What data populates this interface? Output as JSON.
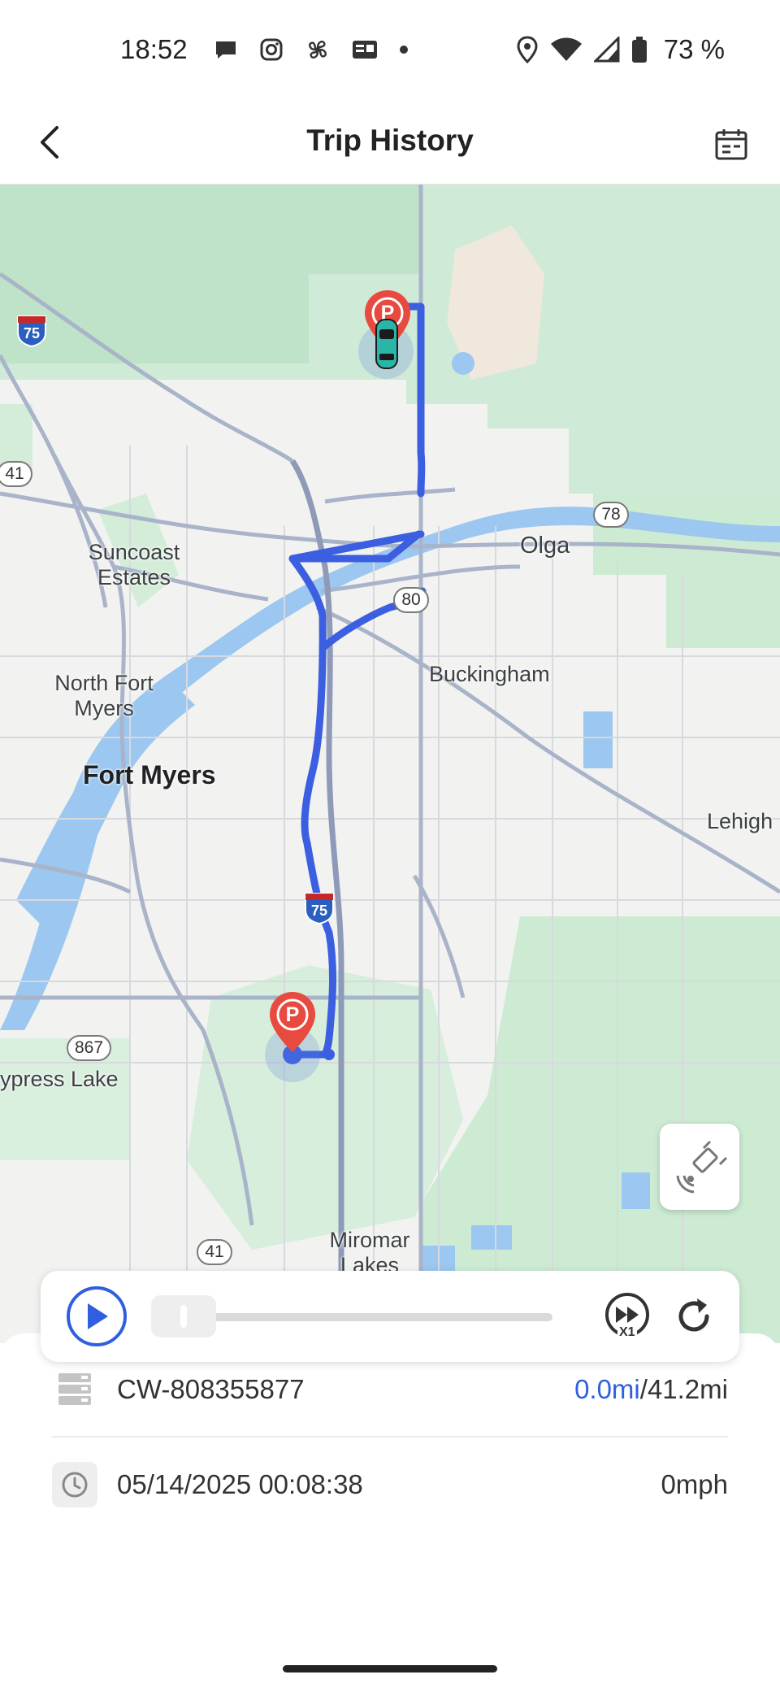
{
  "status_bar": {
    "time": "18:52",
    "battery": "73 %",
    "icons": [
      "chat-icon",
      "instagram-icon",
      "pinwheel-icon",
      "news-icon",
      "dot-icon",
      "location-icon",
      "wifi-icon",
      "signal-icon",
      "battery-icon"
    ]
  },
  "header": {
    "title": "Trip History",
    "back_icon": "chevron-left-icon",
    "calendar_icon": "calendar-icon"
  },
  "map": {
    "labels": {
      "suncoast": "Suncoast\nEstates",
      "olga": "Olga",
      "buckingham": "Buckingham",
      "north_fort_myers": "North Fort\nMyers",
      "fort_myers": "Fort Myers",
      "lehigh": "Lehigh",
      "cypress_lake": "ypress Lake",
      "miromar": "Miromar\nLakes"
    },
    "shields": {
      "i75_top": "75",
      "i75_mid": "75",
      "us41_top": "41",
      "us41_bottom": "41",
      "sr78": "78",
      "sr80": "80",
      "cr867": "867"
    },
    "route_color": "#3b5fe0",
    "parking_marker_label": "P",
    "parking_color": "#e84a3f"
  },
  "playback": {
    "progress": 0.0,
    "speed_label": "X1"
  },
  "trip": {
    "device_id": "CW-808355877",
    "distance_current": "0.0mi",
    "distance_separator": "/",
    "distance_total": "41.2mi",
    "datetime": "05/14/2025 00:08:38",
    "speed": "0mph"
  }
}
